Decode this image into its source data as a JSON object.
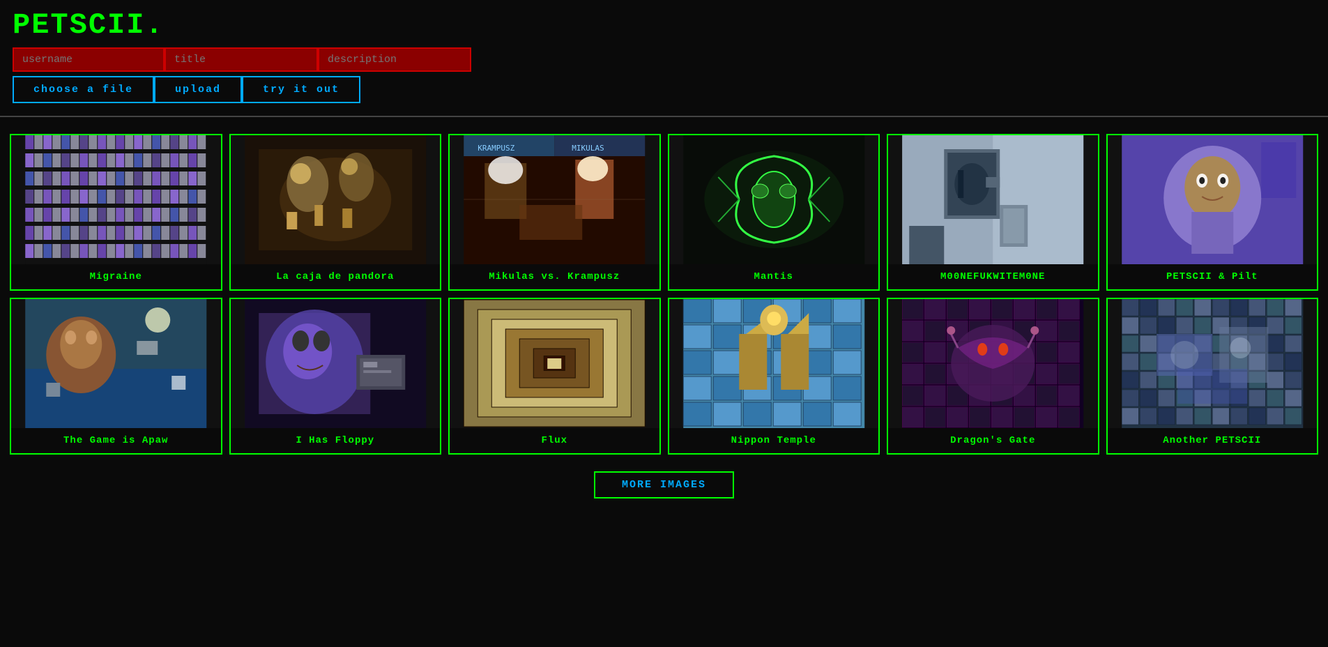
{
  "app": {
    "title": "PETSCII."
  },
  "header": {
    "username_placeholder": "username",
    "title_placeholder": "title",
    "description_placeholder": "description"
  },
  "actions": {
    "choose_file": "choose a file",
    "upload": "upload",
    "try_it_out": "try it out"
  },
  "gallery": {
    "row1": [
      {
        "id": "migraine",
        "title": "Migraine",
        "img_class": "img-migraine"
      },
      {
        "id": "pandora",
        "title": "La caja de pandora",
        "img_class": "img-pandora"
      },
      {
        "id": "mikulas",
        "title": "Mikulas vs. Krampusz",
        "img_class": "img-mikulas"
      },
      {
        "id": "mantis",
        "title": "Mantis",
        "img_class": "img-mantis"
      },
      {
        "id": "moonefuk",
        "title": "M00NEFUKWITEM0NE",
        "img_class": "img-moonefuk"
      },
      {
        "id": "pilt",
        "title": "PETSCII & Pilt",
        "img_class": "img-pilt"
      }
    ],
    "row2": [
      {
        "id": "apaw",
        "title": "The Game is Apaw",
        "img_class": "img-apaw"
      },
      {
        "id": "floppy",
        "title": "I Has Floppy",
        "img_class": "img-floppy"
      },
      {
        "id": "flux",
        "title": "Flux",
        "img_class": "img-flux"
      },
      {
        "id": "nippon",
        "title": "Nippon Temple",
        "img_class": "img-nippon"
      },
      {
        "id": "dragon",
        "title": "Dragon's Gate",
        "img_class": "img-dragon"
      },
      {
        "id": "anotherpetscii",
        "title": "Another PETSCII",
        "img_class": "img-anotherpetscii"
      }
    ]
  },
  "more_button": {
    "label": "MORE IMAGES"
  }
}
